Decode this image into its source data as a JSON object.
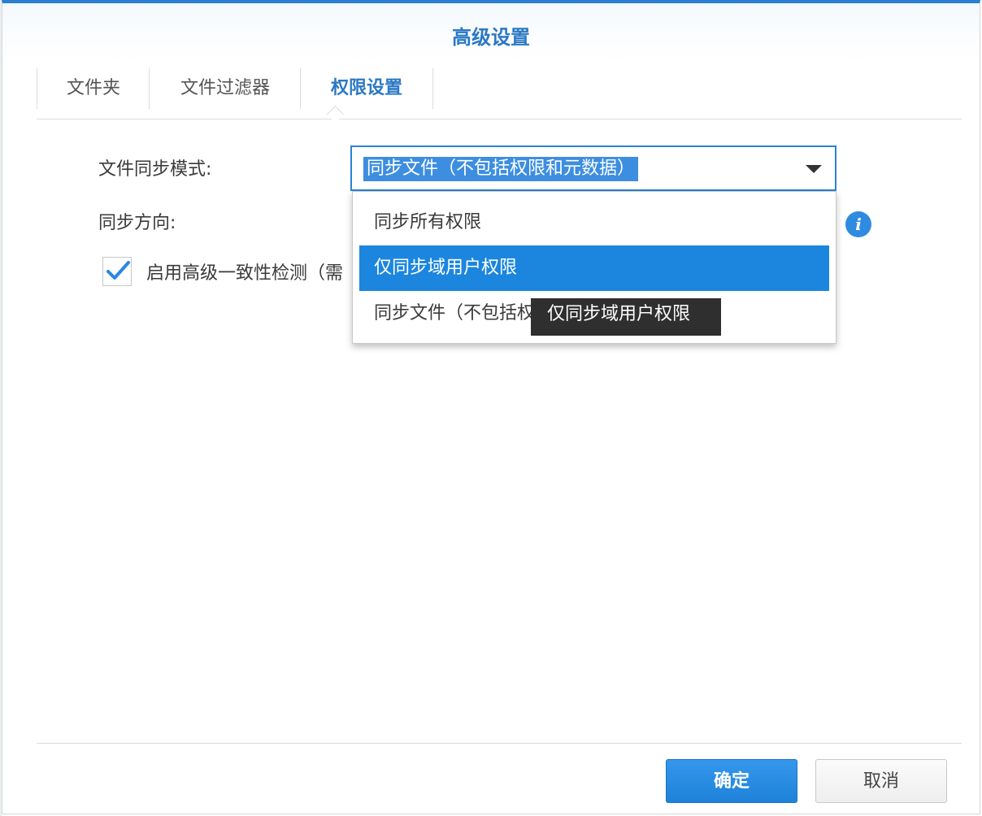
{
  "dialog": {
    "title": "高级设置"
  },
  "tabs": [
    {
      "label": "文件夹"
    },
    {
      "label": "文件过滤器"
    },
    {
      "label": "权限设置"
    }
  ],
  "form": {
    "sync_mode_label": "文件同步模式:",
    "sync_mode_value": "同步文件（不包括权限和元数据）",
    "sync_direction_label": "同步方向:",
    "consistency_check_label": "启用高级一致性检测（需",
    "consistency_check_checked": true
  },
  "dropdown": {
    "options": [
      {
        "label": "同步所有权限",
        "selected": false
      },
      {
        "label": "仅同步域用户权限",
        "selected": true
      },
      {
        "label": "同步文件（不包括权",
        "selected": false
      }
    ]
  },
  "tooltip": {
    "text": "仅同步域用户权限"
  },
  "info": {
    "icon": "info-icon",
    "glyph": "i"
  },
  "buttons": {
    "ok_label": "确定",
    "cancel_label": "取消"
  },
  "colors": {
    "accent": "#2b78c4",
    "selected_option": "#1c86de",
    "tooltip_bg": "#2f2f2f"
  }
}
